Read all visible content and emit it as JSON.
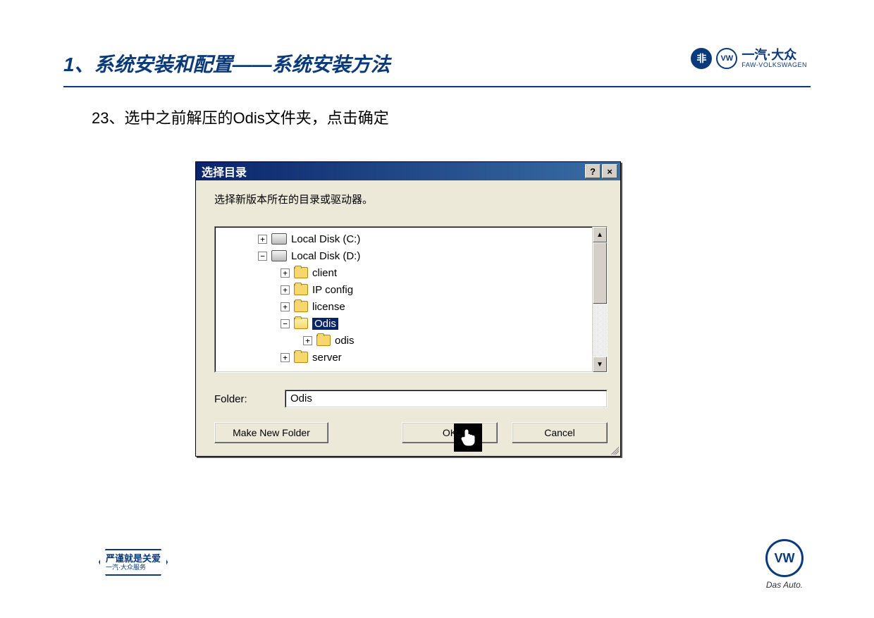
{
  "header": {
    "title": "1、系统安装和配置——系统安装方法",
    "brand_main": "一汽·大众",
    "brand_sub": "FAW-VOLKSWAGEN"
  },
  "step": "23、选中之前解压的Odis文件夹，点击确定",
  "dialog": {
    "title": "选择目录",
    "prompt": "选择新版本所在的目录或驱动器。",
    "help_btn": "?",
    "close_btn": "×",
    "tree": {
      "c_drive": "Local Disk (C:)",
      "d_drive": "Local Disk (D:)",
      "client": "client",
      "ip_config": "IP config",
      "license": "license",
      "odis_sel": "Odis",
      "odis_sub": "odis",
      "server": "server"
    },
    "folder_label": "Folder:",
    "folder_value": "Odis",
    "make_new": "Make New Folder",
    "ok": "OK",
    "cancel": "Cancel"
  },
  "footer": {
    "left_main": "严谨就是关爱",
    "left_sub": "一汽·大众服务",
    "das_auto": "Das Auto."
  }
}
